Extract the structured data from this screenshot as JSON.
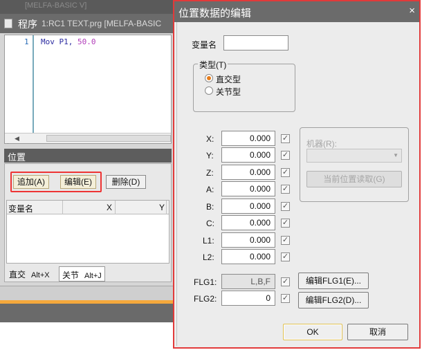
{
  "background_window": {
    "top_strip_text": "[MELFA-BASIC V]",
    "title": "程序",
    "subtitle": "1:RC1 TEXT.prg   [MELFA-BASIC",
    "editor": {
      "line_number": "1",
      "code_kw": "Mov P1,",
      "code_num": "50.0"
    },
    "position_panel": {
      "header": "位置",
      "add_label": "追加(A)",
      "edit_label": "编辑(E)",
      "delete_label": "删除(D)",
      "columns": [
        "变量名",
        "X",
        "Y"
      ],
      "tabs": [
        {
          "label": "直交",
          "shortcut": "Alt+X"
        },
        {
          "label": "关节",
          "shortcut": "Alt+J"
        }
      ]
    }
  },
  "dialog": {
    "title": "位置数据的编辑",
    "close_glyph": "×",
    "var_name_label": "变量名",
    "var_name_value": "",
    "type_group": {
      "label": "类型(T)",
      "options": [
        {
          "label": "直交型",
          "selected": true
        },
        {
          "label": "关节型",
          "selected": false
        }
      ]
    },
    "axes": [
      {
        "label": "X:",
        "value": "0.000",
        "checked": true
      },
      {
        "label": "Y:",
        "value": "0.000",
        "checked": true
      },
      {
        "label": "Z:",
        "value": "0.000",
        "checked": true
      },
      {
        "label": "A:",
        "value": "0.000",
        "checked": true
      },
      {
        "label": "B:",
        "value": "0.000",
        "checked": true
      },
      {
        "label": "C:",
        "value": "0.000",
        "checked": true
      },
      {
        "label": "L1:",
        "value": "0.000",
        "checked": true
      },
      {
        "label": "L2:",
        "value": "0.000",
        "checked": true
      }
    ],
    "flags": [
      {
        "label": "FLG1:",
        "value": "L,B,F",
        "checked": true,
        "button": "编辑FLG1(E)..."
      },
      {
        "label": "FLG2:",
        "value": "0",
        "checked": true,
        "button": "编辑FLG2(D)..."
      }
    ],
    "robot_group": {
      "label": "机器(R):",
      "selected": "",
      "read_current_label": "当前位置读取(G)"
    },
    "ok_label": "OK",
    "cancel_label": "取消"
  }
}
